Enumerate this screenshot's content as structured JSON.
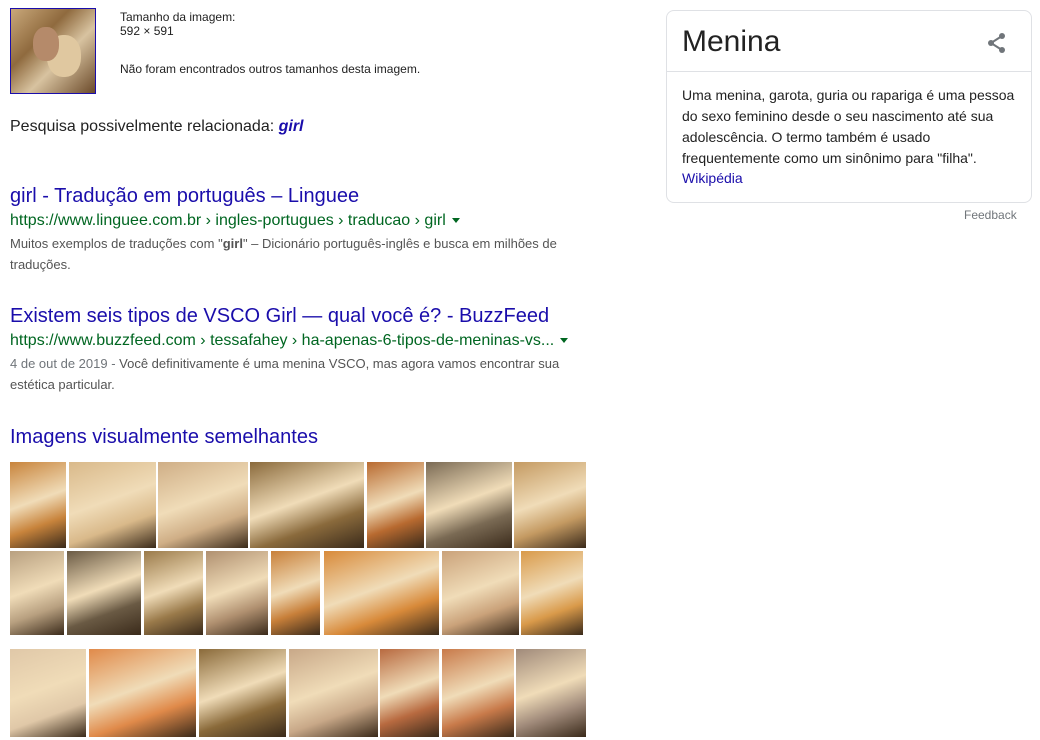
{
  "image_info": {
    "size_label": "Tamanho da imagem:",
    "size_value": "592 × 591",
    "no_sizes": "Não foram encontrados outros tamanhos desta imagem."
  },
  "related": {
    "prefix": "Pesquisa possivelmente relacionada:",
    "query": "girl"
  },
  "results": [
    {
      "title": "girl - Tradução em português – Linguee",
      "url": "https://www.linguee.com.br › ingles-portugues › traducao › girl",
      "date": "",
      "snippet_before": "Muitos exemplos de traduções com \"",
      "snippet_bold": "girl",
      "snippet_after": "\" – Dicionário português-inglês e busca em milhões de",
      "snippet_line2": "traduções."
    },
    {
      "title": "Existem seis tipos de VSCO Girl — qual você é? - BuzzFeed",
      "url": "https://www.buzzfeed.com › tessafahey › ha-apenas-6-tipos-de-meninas-vs...",
      "date": "4 de out de 2019 - ",
      "snippet_before": "Você definitivamente é uma menina VSCO, mas agora vamos encontrar sua",
      "snippet_bold": "",
      "snippet_after": "",
      "snippet_line2": "estética particular."
    }
  ],
  "similar_heading": "Imagens visualmente semelhantes",
  "similar_images": [
    {
      "color": "#c8843c"
    },
    {
      "color": "#d9b98a"
    },
    {
      "color": "#cfae86"
    },
    {
      "color": "#8a6a3c"
    },
    {
      "color": "#b86a30"
    },
    {
      "color": "#7a6a54"
    },
    {
      "color": "#c49a62"
    },
    {
      "color": "#b8a080"
    },
    {
      "color": "#6a5a44"
    },
    {
      "color": "#9a7a4a"
    },
    {
      "color": "#b09070"
    },
    {
      "color": "#c8803a"
    },
    {
      "color": "#d88a3a"
    },
    {
      "color": "#caa27a"
    },
    {
      "color": "#d99a4a"
    },
    {
      "color": "#e0c8a8"
    },
    {
      "color": "#e08a4a"
    },
    {
      "color": "#8a6a3a"
    },
    {
      "color": "#c8a888"
    },
    {
      "color": "#b86a40"
    },
    {
      "color": "#c87a4a"
    },
    {
      "color": "#a08a7a"
    }
  ],
  "knowledge_panel": {
    "title": "Menina",
    "description": "Uma menina, garota, guria ou rapariga é uma pessoa do sexo feminino desde o seu nascimento até sua adolescência. O termo também é usado frequentemente como um sinônimo para \"filha\".",
    "source": "Wikipédia",
    "feedback": "Feedback"
  }
}
